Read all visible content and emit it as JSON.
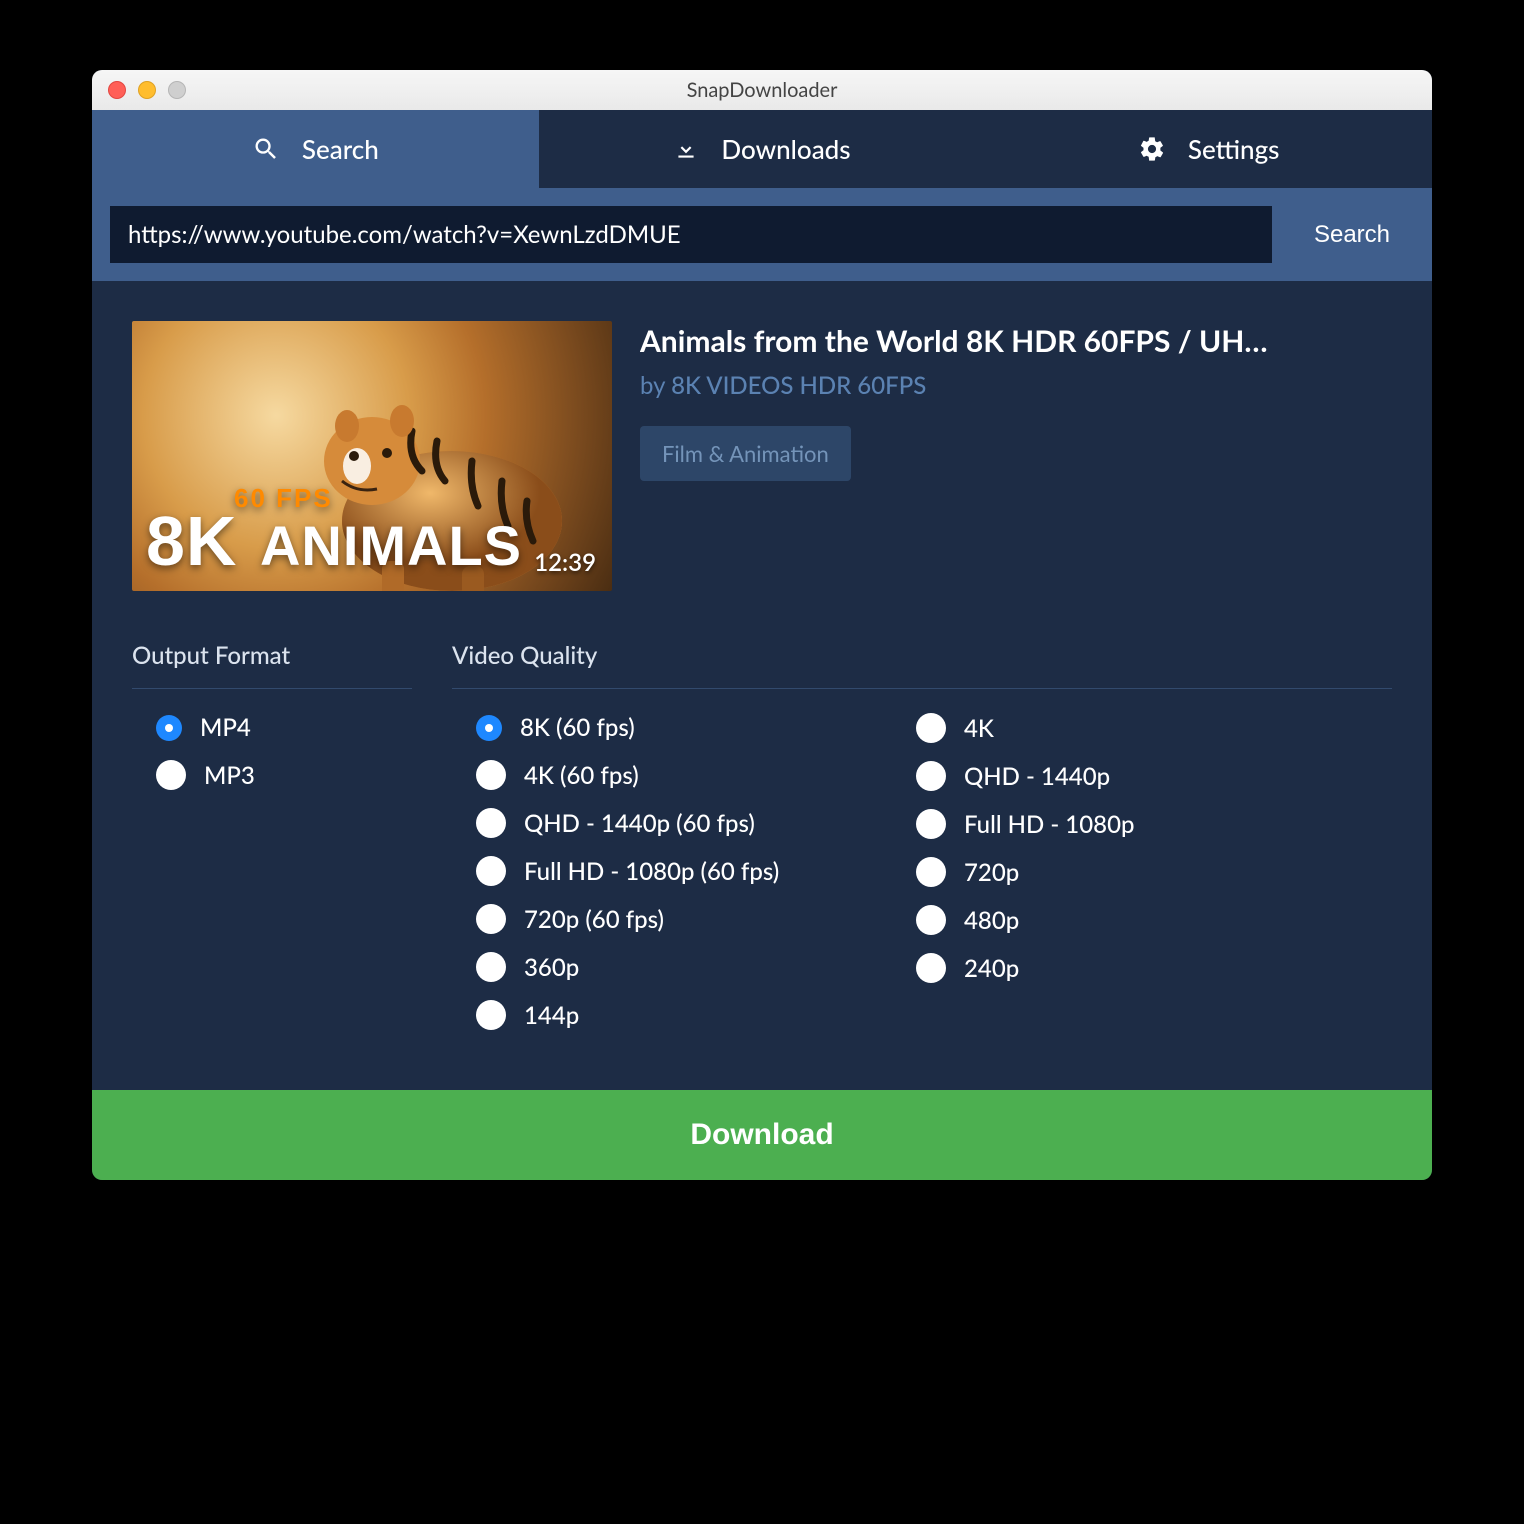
{
  "window": {
    "title": "SnapDownloader"
  },
  "tabs": {
    "search": "Search",
    "downloads": "Downloads",
    "settings": "Settings"
  },
  "searchbar": {
    "url": "https://www.youtube.com/watch?v=XewnLzdDMUE",
    "button": "Search"
  },
  "video": {
    "title": "Animals from the World 8K HDR 60FPS / UH…",
    "by_prefix": "by ",
    "channel": "8K VIDEOS HDR 60FPS",
    "category": "Film & Animation",
    "duration": "12:39",
    "thumb_text_top": "60 FPS",
    "thumb_text_main_left": "8K",
    "thumb_text_main_right": "ANIMALS"
  },
  "sections": {
    "output_format": "Output Format",
    "video_quality": "Video Quality"
  },
  "formats": [
    {
      "label": "MP4",
      "selected": true
    },
    {
      "label": "MP3",
      "selected": false
    }
  ],
  "qualities_col1": [
    {
      "label": "8K (60 fps)",
      "selected": true
    },
    {
      "label": "4K (60 fps)",
      "selected": false
    },
    {
      "label": "QHD - 1440p (60 fps)",
      "selected": false
    },
    {
      "label": "Full HD - 1080p (60 fps)",
      "selected": false
    },
    {
      "label": "720p (60 fps)",
      "selected": false
    },
    {
      "label": "360p",
      "selected": false
    },
    {
      "label": "144p",
      "selected": false
    }
  ],
  "qualities_col2": [
    {
      "label": "4K",
      "selected": false
    },
    {
      "label": "QHD - 1440p",
      "selected": false
    },
    {
      "label": "Full HD - 1080p",
      "selected": false
    },
    {
      "label": "720p",
      "selected": false
    },
    {
      "label": "480p",
      "selected": false
    },
    {
      "label": "240p",
      "selected": false
    }
  ],
  "download_button": "Download"
}
